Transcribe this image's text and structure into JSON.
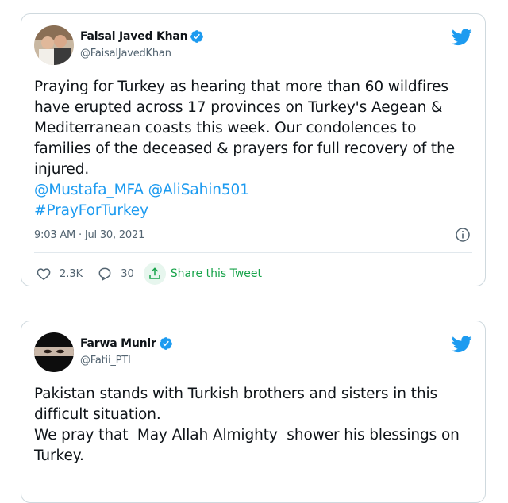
{
  "colors": {
    "accent": "#1d9bf0",
    "share": "#17a34a",
    "text": "#0f1419",
    "muted": "#536471"
  },
  "tweets": [
    {
      "name": "Faisal Javed Khan",
      "handle": "@FaisalJavedKhan",
      "verified": true,
      "text": "Praying for Turkey as hearing that more than 60 wildfires\nhave erupted across 17 provinces on Turkey's Aegean &\nMediterranean coasts this week. Our condolences to\nfamilies of the deceased & prayers for full recovery of the\ninjured.",
      "mentions": "@Mustafa_MFA @AliSahin501",
      "hashtag": "#PrayForTurkey",
      "timestamp": "9:03 AM · Jul 30, 2021",
      "likes": "2.3K",
      "replies": "30",
      "share_label": "Share this Tweet",
      "icons": [
        "heart-icon",
        "reply-icon",
        "share-icon",
        "info-icon",
        "twitter-bird-icon",
        "verified-badge-icon"
      ]
    },
    {
      "name": "Farwa Munir",
      "handle": "@Fatii_PTI",
      "verified": true,
      "text": "Pakistan stands with Turkish brothers and sisters in this\ndifficult situation.\nWe pray that  May Allah Almighty  shower his blessings on\nTurkey.",
      "icons": [
        "twitter-bird-icon",
        "verified-badge-icon"
      ]
    }
  ]
}
